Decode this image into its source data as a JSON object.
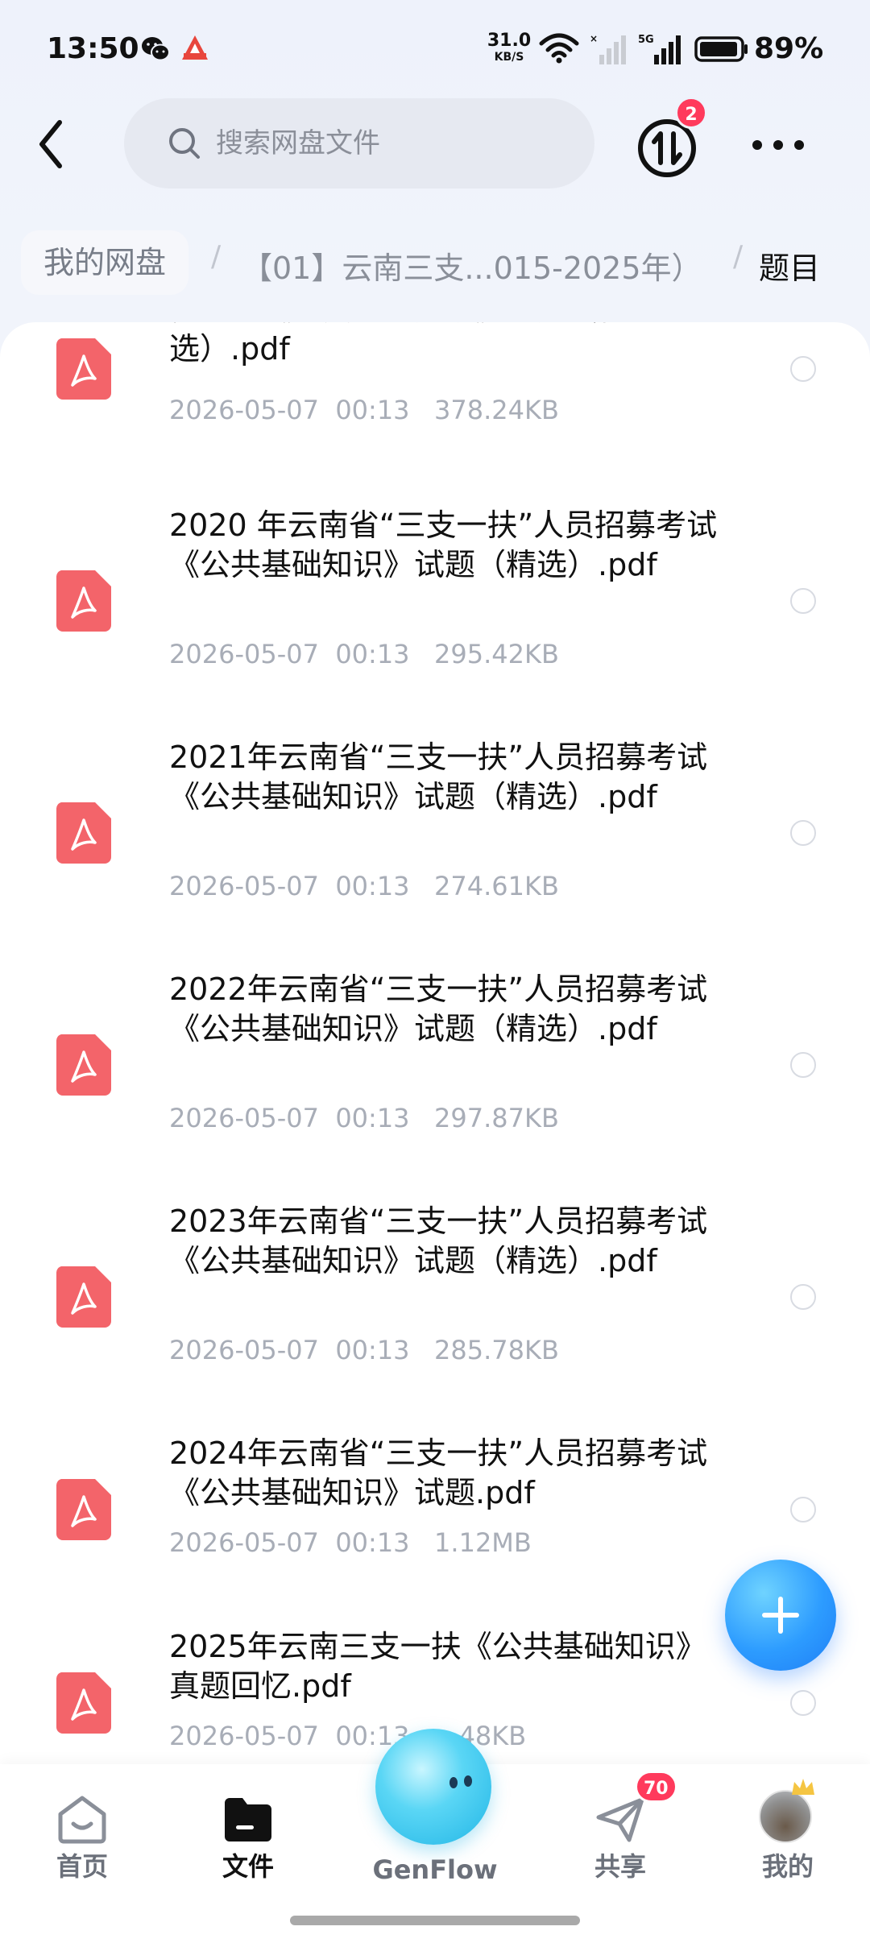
{
  "status_bar": {
    "time": "13:50",
    "net_speed_value": "31.0",
    "net_speed_unit": "KB/S",
    "signal_label": "5G",
    "battery": "89%"
  },
  "header": {
    "search_placeholder": "搜索网盘文件",
    "transfer_badge": "2"
  },
  "breadcrumb": {
    "root": "我的网盘",
    "middle": "【01】云南三支...015-2025年）",
    "current": "题目"
  },
  "files": [
    {
      "name": "募考试《公共基础知识》试题（精选）.pdf",
      "meta": "2026-05-07  00:13   378.24KB"
    },
    {
      "name": "2020 年云南省“三支一扶”人员招募考试《公共基础知识》试题（精选）.pdf",
      "meta": "2026-05-07  00:13   295.42KB"
    },
    {
      "name": "2021年云南省“三支一扶”人员招募考试《公共基础知识》试题（精选）.pdf",
      "meta": "2026-05-07  00:13   274.61KB"
    },
    {
      "name": "2022年云南省“三支一扶”人员招募考试《公共基础知识》试题（精选）.pdf",
      "meta": "2026-05-07  00:13   297.87KB"
    },
    {
      "name": "2023年云南省“三支一扶”人员招募考试《公共基础知识》试题（精选）.pdf",
      "meta": "2026-05-07  00:13   285.78KB"
    },
    {
      "name": "2024年云南省“三支一扶”人员招募考试《公共基础知识》试题.pdf",
      "meta": "2026-05-07  00:13   1.12MB"
    },
    {
      "name": "2025年云南三支一扶《公共基础知识》真题回忆.pdf",
      "meta": "2026-05-07  00:13   ...48KB"
    }
  ],
  "bottom_nav": {
    "home": "首页",
    "files": "文件",
    "genflow": "GenFlow",
    "share": "共享",
    "share_badge": "70",
    "mine": "我的"
  },
  "colors": {
    "pdf_icon": "#f3646a",
    "fab": "#2d9cff",
    "badge": "#ff3a5c"
  }
}
